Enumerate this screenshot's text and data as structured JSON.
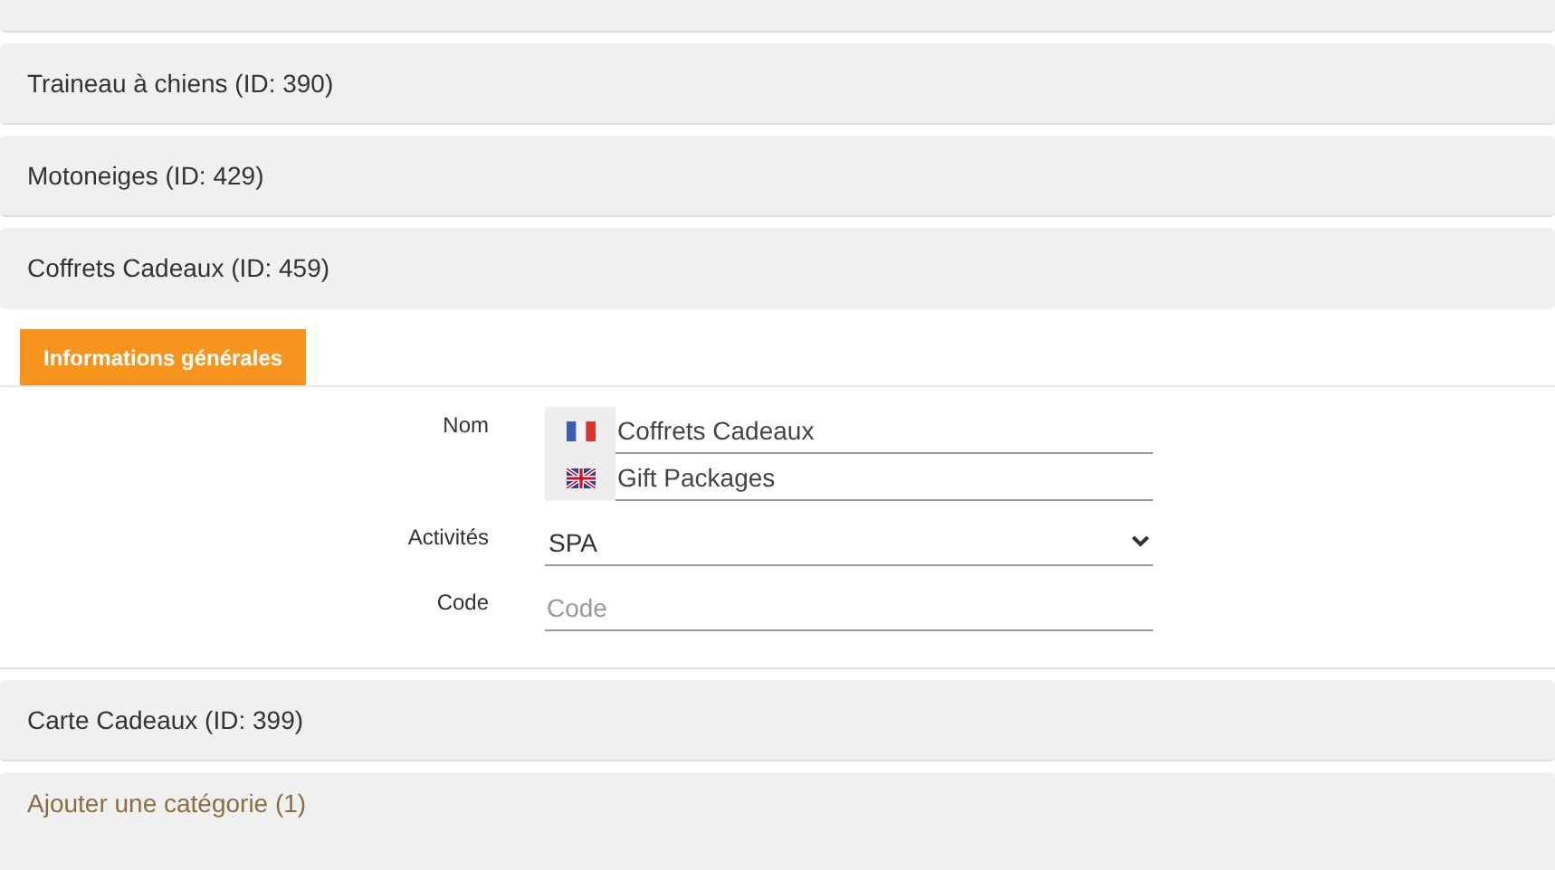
{
  "sections": [
    {
      "title": "Traineau à chiens (ID: 390)",
      "kind": "category",
      "expanded": false
    },
    {
      "title": "Motoneiges (ID: 429)",
      "kind": "category",
      "expanded": false
    },
    {
      "title": "Coffrets Cadeaux (ID: 459)",
      "kind": "category",
      "expanded": true,
      "tabs": [
        {
          "label": "Informations générales",
          "selected": true
        }
      ],
      "fields": [
        {
          "label": "Nom",
          "kind": "translations",
          "entries": [
            {
              "kind": "french",
              "value": "Coffrets Cadeaux"
            },
            {
              "kind": "british",
              "value": "Gift Packages"
            }
          ]
        },
        {
          "label": "Activités",
          "kind": "select",
          "value": "SPA"
        },
        {
          "label": "Code",
          "kind": "text",
          "placeholder": "Code"
        }
      ]
    },
    {
      "title": "Carte Cadeaux (ID: 399)",
      "kind": "category",
      "expanded": false
    },
    {
      "title": "Ajouter une catégorie (1)",
      "kind": "add",
      "expanded": false
    }
  ]
}
